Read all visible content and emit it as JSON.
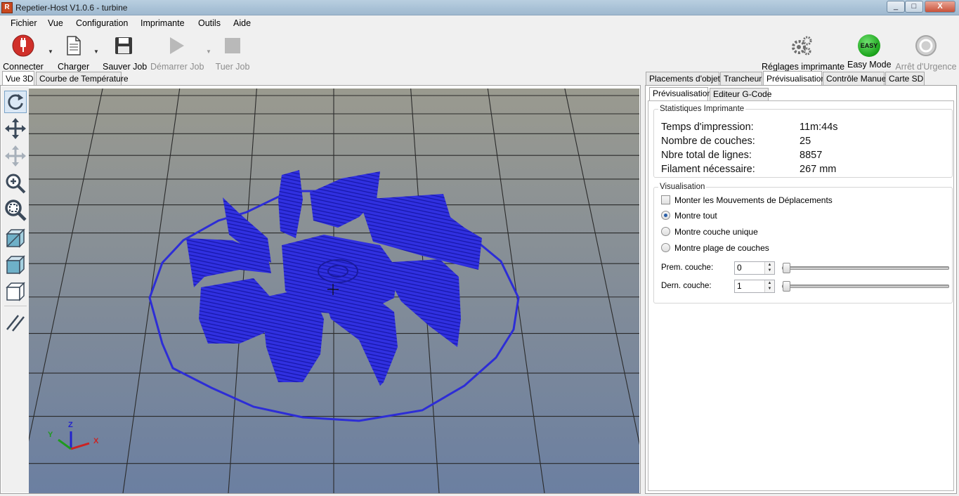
{
  "window": {
    "title": "Repetier-Host V1.0.6 - turbine",
    "app_icon": "R"
  },
  "window_controls": {
    "minimize": "_",
    "maximize": "□",
    "close": "X"
  },
  "menu": [
    "Fichier",
    "Vue",
    "Configuration",
    "Imprimante",
    "Outils",
    "Aide"
  ],
  "toolbar": {
    "connect": "Connecter",
    "load": "Charger",
    "save_job": "Sauver Job",
    "start_job": "Démarrer Job",
    "kill_job": "Tuer Job",
    "printer_settings": "Réglages imprimante",
    "easy_mode": "Easy Mode",
    "easy_badge": "EASY",
    "emergency_stop": "Arrêt d'Urgence"
  },
  "left_tabs": [
    "Vue 3D",
    "Courbe de Température"
  ],
  "right_tabs": [
    "Placements d'objets",
    "Trancheur",
    "Prévisualisation",
    "Contrôle Manuel",
    "Carte SD"
  ],
  "preview_tabs": [
    "Prévisualisation",
    "Editeur G-Code"
  ],
  "stats": {
    "legend": "Statistiques Imprimante",
    "rows": [
      {
        "label": "Temps d'impression:",
        "value": "11m:44s"
      },
      {
        "label": "Nombre de couches:",
        "value": "25"
      },
      {
        "label": "Nbre total de lignes:",
        "value": "8857"
      },
      {
        "label": "Filament nécessaire:",
        "value": "267 mm"
      }
    ]
  },
  "visualisation": {
    "legend": "Visualisation",
    "show_travel": "Monter les Mouvements de Déplacements",
    "show_all": "Montre tout",
    "single_layer": "Montre couche unique",
    "layer_range": "Montre plage de couches",
    "selected": "show_all",
    "first_layer_label": "Prem. couche:",
    "first_layer_value": "0",
    "last_layer_label": "Dern. couche:",
    "last_layer_value": "1"
  },
  "axes": {
    "x": "X",
    "y": "Y",
    "z": "Z"
  },
  "colors": {
    "model": "#2a2ad8",
    "bed_top": "#9a9a8f",
    "bed_bottom": "#6b7fa1",
    "accent": "#c0392b"
  }
}
